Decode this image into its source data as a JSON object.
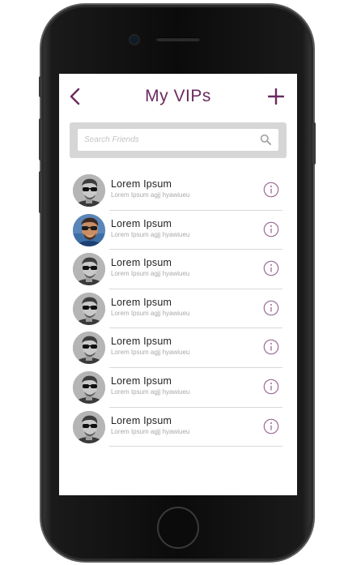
{
  "header": {
    "title": "My VIPs",
    "back_icon": "chevron-left-icon",
    "add_icon": "plus-icon"
  },
  "search": {
    "placeholder": "Search Friends",
    "value": "",
    "icon": "search-icon"
  },
  "friends": [
    {
      "name": "Lorem Ipsum",
      "subtitle": "Lorem Ipsum agjj hyawiueu",
      "avatar": "avatar-grey",
      "icon": "info-icon"
    },
    {
      "name": "Lorem Ipsum",
      "subtitle": "Lorem Ipsum agjj hyawiueu",
      "avatar": "avatar-color",
      "icon": "info-icon"
    },
    {
      "name": "Lorem Ipsum",
      "subtitle": "Lorem Ipsum agjj hyawiueu",
      "avatar": "avatar-grey",
      "icon": "info-icon"
    },
    {
      "name": "Lorem Ipsum",
      "subtitle": "Lorem Ipsum agjj hyawiueu",
      "avatar": "avatar-grey",
      "icon": "info-icon"
    },
    {
      "name": "Lorem Ipsum",
      "subtitle": "Lorem Ipsum agjj hyawiueu",
      "avatar": "avatar-grey",
      "icon": "info-icon"
    },
    {
      "name": "Lorem Ipsum",
      "subtitle": "Lorem Ipsum agjj hyawiueu",
      "avatar": "avatar-grey",
      "icon": "info-icon"
    },
    {
      "name": "Lorem Ipsum",
      "subtitle": "Lorem Ipsum agjj hyawiueu",
      "avatar": "avatar-grey",
      "icon": "info-icon"
    }
  ],
  "colors": {
    "accent": "#6b2b5e",
    "info": "#9b6b94",
    "divider": "#d8d8d8"
  }
}
